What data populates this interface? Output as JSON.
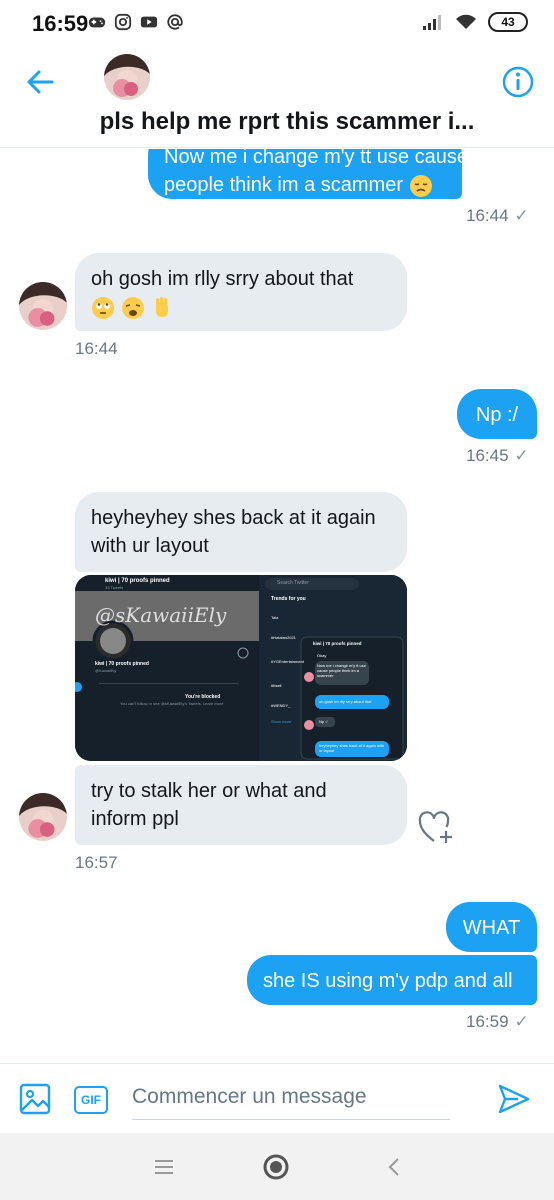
{
  "status_bar": {
    "time": "16:59",
    "battery": "43"
  },
  "header": {
    "title": "pls help me rprt this scammer i..."
  },
  "messages": [
    {
      "direction": "out",
      "text_line1": "Now me i change m'y tt use cause",
      "text_line2": "people think im a scammer",
      "emoji": "disappointed-face",
      "time": "16:44"
    },
    {
      "direction": "in",
      "text": "oh gosh im rlly srry about that",
      "emoji": [
        "face-with-rolling-eyes",
        "weary-face",
        "raised-hand"
      ],
      "time": "16:44"
    },
    {
      "direction": "out",
      "text": "Np :/",
      "time": "16:45"
    },
    {
      "direction": "in",
      "text_line1": "heyheyhey shes back at it again",
      "text_line2": "with ur layout"
    },
    {
      "direction": "in",
      "text_line1": "try to stalk her or what and",
      "text_line2": "inform ppl",
      "time": "16:57"
    },
    {
      "direction": "out",
      "text": "WHAT"
    },
    {
      "direction": "out",
      "text": "she IS using m'y pdp and all",
      "time": "16:59"
    }
  ],
  "embed": {
    "profile_name": "kiwi | 70 proofs pinned",
    "tweets": "33 Tweets",
    "banner_text": "@sKawaiiEly",
    "handle": "@KawaiiEly",
    "blocked_title": "You're blocked",
    "blocked_text": "You can't follow or see @sKawaiiEly's Tweets. Learn more",
    "search": "Search Twitter",
    "trends_title": "Trends for you",
    "trends": [
      "Tala",
      "#Hatalan2021",
      "#YGEntertainment",
      "#Itsell",
      "#WENDY_",
      "Show more"
    ],
    "chat_title": "kiwi | 70 proofs pinned",
    "chat_msgs": [
      "Okay",
      "Now me i change m'y tt use cause people think im a scammer",
      "oh gosh im rlly srry about that",
      "Np :/",
      "heyheyhey shes back at it again with ur layout"
    ]
  },
  "composer": {
    "placeholder": "Commencer un message",
    "gif_label": "GIF"
  },
  "colors": {
    "accent": "#1da1f2",
    "incoming_bubble": "#e6ecf0",
    "timestamp": "#657786"
  }
}
